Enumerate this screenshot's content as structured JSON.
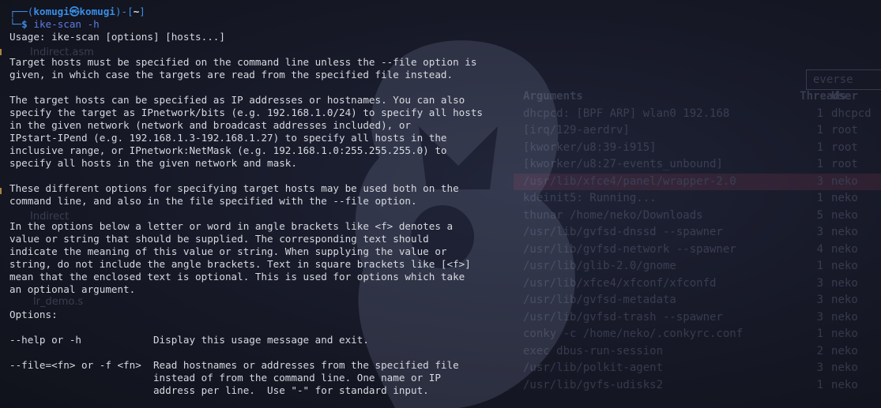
{
  "prompt": {
    "corner_top": "┌──(",
    "user": "komugi",
    "at_symbol": "㉿",
    "host": "komugi",
    "bracket_mid": ")-[",
    "directory": "~",
    "bracket_end": "]",
    "corner_bottom": "└─",
    "dollar": "$",
    "command": "ike-scan -h"
  },
  "output_lines": [
    "Usage: ike-scan [options] [hosts...]",
    "",
    "Target hosts must be specified on the command line unless the --file option is",
    "given, in which case the targets are read from the specified file instead.",
    "",
    "The target hosts can be specified as IP addresses or hostnames. You can also",
    "specify the target as IPnetwork/bits (e.g. 192.168.1.0/24) to specify all hosts",
    "in the given network (network and broadcast addresses included), or",
    "IPstart-IPend (e.g. 192.168.1.3-192.168.1.27) to specify all hosts in the",
    "inclusive range, or IPnetwork:NetMask (e.g. 192.168.1.0:255.255.255.0) to",
    "specify all hosts in the given network and mask.",
    "",
    "These different options for specifying target hosts may be used both on the",
    "command line, and also in the file specified with the --file option.",
    "",
    "In the options below a letter or word in angle brackets like <f> denotes a",
    "value or string that should be supplied. The corresponding text should",
    "indicate the meaning of this value or string. When supplying the value or",
    "string, do not include the angle brackets. Text in square brackets like [<f>]",
    "mean that the enclosed text is optional. This is used for options which take",
    "an optional argument.",
    "",
    "Options:",
    "",
    "--help or -h            Display this usage message and exit.",
    "",
    "--file=<fn> or -f <fn>  Read hostnames or addresses from the specified file",
    "                        instead of from the command line. One name or IP",
    "                        address per line.  Use \"-\" for standard input."
  ],
  "background_window": {
    "search_text": "everse",
    "headers": {
      "args": "Arguments",
      "threads": "Threads",
      "user": "User"
    },
    "rows": [
      {
        "args": "dhcpcd: [BPF ARP] wlan0 192.168",
        "threads": "1",
        "user": "dhcpcd"
      },
      {
        "args": "[irq/129-aerdrv]",
        "threads": "1",
        "user": "root"
      },
      {
        "args": "[kworker/u8:39-i915]",
        "threads": "1",
        "user": "root"
      },
      {
        "args": "[kworker/u8:27-events_unbound]",
        "threads": "1",
        "user": "root"
      },
      {
        "args": "/usr/lib/xfce4/panel/wrapper-2.0",
        "threads": "3",
        "user": "neko"
      },
      {
        "args": "kdeinit5: Running...",
        "threads": "1",
        "user": "neko"
      },
      {
        "args": "thunar /home/neko/Downloads",
        "threads": "5",
        "user": "neko"
      },
      {
        "args": "/usr/lib/gvfsd-dnssd --spawner",
        "threads": "3",
        "user": "neko"
      },
      {
        "args": "/usr/lib/gvfsd-network --spawner",
        "threads": "4",
        "user": "neko"
      },
      {
        "args": "/usr/lib/glib-2.0/gnome",
        "threads": "1",
        "user": "neko"
      },
      {
        "args": "/usr/lib/xfce4/xfconf/xfconfd",
        "threads": "3",
        "user": "neko"
      },
      {
        "args": "/usr/lib/gvfsd-metadata",
        "threads": "3",
        "user": "neko"
      },
      {
        "args": "/usr/lib/gvfsd-trash --spawner",
        "threads": "3",
        "user": "neko"
      },
      {
        "args": "conky -c /home/neko/.conkyrc.conf",
        "threads": "1",
        "user": "neko"
      },
      {
        "args": "exec dbus-run-session",
        "threads": "2",
        "user": "neko"
      },
      {
        "args": "/usr/lib/polkit-agent",
        "threads": "3",
        "user": "neko"
      },
      {
        "args": "/usr/lib/gvfs-udisks2",
        "threads": "1",
        "user": "neko"
      }
    ]
  },
  "background_sidebar": [
    "Indirect.asm",
    "Indirect",
    "lr_demo.s"
  ],
  "colors": {
    "background": "#161826",
    "prompt_accent": "#3a8ee6",
    "command": "#5c7ce0",
    "text": "#d7dae0",
    "highlight_row": "#c8506e"
  }
}
